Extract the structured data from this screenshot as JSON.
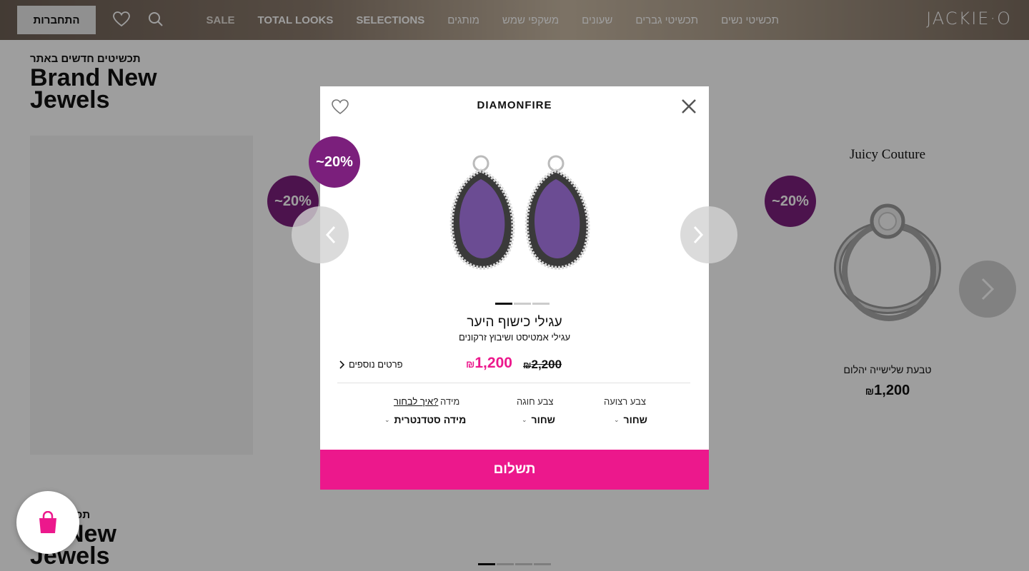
{
  "header": {
    "logo": "JACKIE·O",
    "nav": [
      {
        "label": "תכשיטי נשים",
        "bold": false
      },
      {
        "label": "תכשיטי גברים",
        "bold": false
      },
      {
        "label": "שעונים",
        "bold": false
      },
      {
        "label": "משקפי שמש",
        "bold": false
      },
      {
        "label": "מותגים",
        "bold": false
      },
      {
        "label": "SELECTIONS",
        "bold": true
      },
      {
        "label": "TOTAL LOOKS",
        "bold": true
      },
      {
        "label": "SALE",
        "bold": true
      }
    ],
    "login_label": "התחברות"
  },
  "section": {
    "small_title": "תכשיטים חדשים באתר",
    "big_title_line1": "Brand New",
    "big_title_line2": "Jewels"
  },
  "section2": {
    "small_title": "תכשיטים חד",
    "big_title_line1": "nd New",
    "big_title_line2": "Jewels"
  },
  "background_cards": [
    {
      "brand": "Juicy Couture",
      "title": "טבעת שלישייה יהלום",
      "price": "1,200",
      "currency": "₪",
      "badge": "~20%"
    }
  ],
  "badge_text": "~20%",
  "modal": {
    "brand": "DIAMONFIRE",
    "title": "עגילי כישוף היער",
    "subtitle": "עגילי אמטיסט ושיבוץ זרקונים",
    "price_old": "2,200",
    "price_new": "1,200",
    "currency": "₪",
    "details_label": "פרטים נוספים",
    "options": {
      "stone_color_label": "צבע רצועה",
      "stone_color_value": "שחור",
      "buckle_color_label": "צבע חוגה",
      "buckle_color_value": "שחור",
      "size_label": "מידה",
      "size_value": "מידה סטדנטרית",
      "how_to_choose": "איך לבחור?"
    },
    "pay_label": "תשלום"
  },
  "colors": {
    "accent": "#ec188c",
    "badge": "#7b1f7c"
  }
}
